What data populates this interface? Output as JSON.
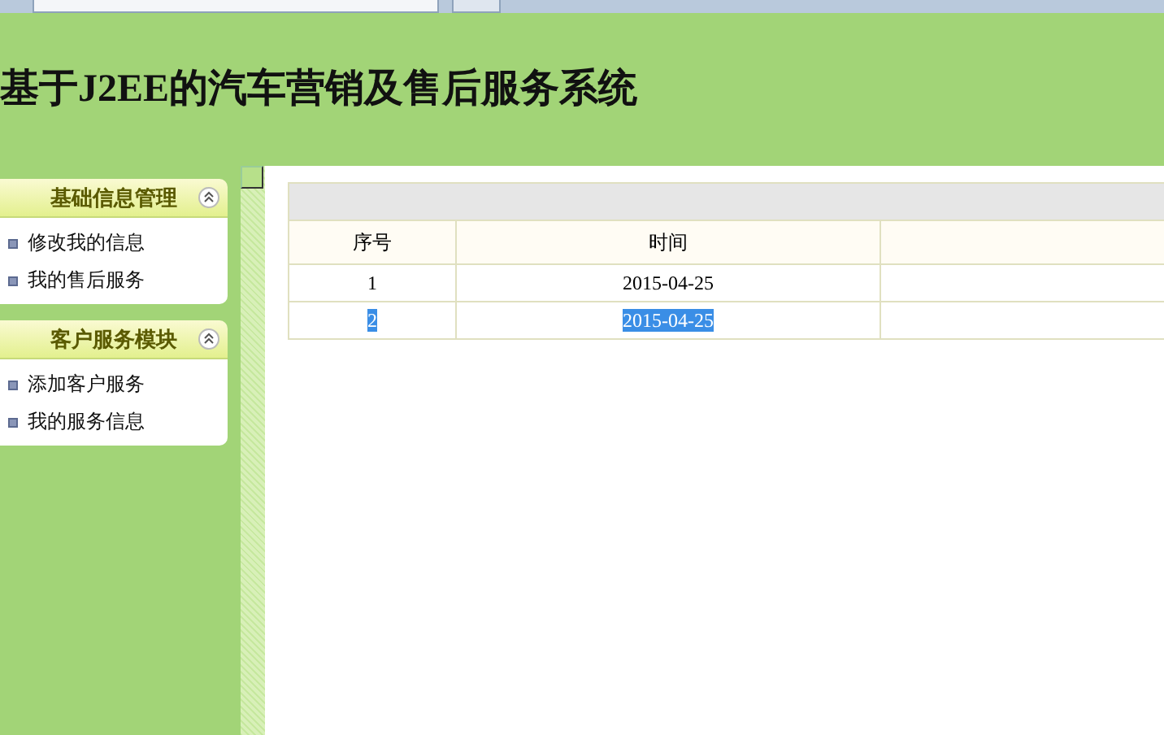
{
  "header": {
    "title": "基于J2EE的汽车营销及售后服务系统"
  },
  "sidebar": {
    "panels": [
      {
        "title": "基础信息管理",
        "expanded": true,
        "items": [
          "修改我的信息",
          "我的售后服务"
        ]
      },
      {
        "title": "客户服务模块",
        "expanded": true,
        "items": [
          "添加客户服务",
          "我的服务信息"
        ]
      }
    ]
  },
  "table": {
    "columns": [
      "序号",
      "时间"
    ],
    "rows": [
      {
        "cells": [
          "1",
          "2015-04-25"
        ],
        "selected": false
      },
      {
        "cells": [
          "2",
          "2015-04-25"
        ],
        "selected": true
      }
    ]
  }
}
